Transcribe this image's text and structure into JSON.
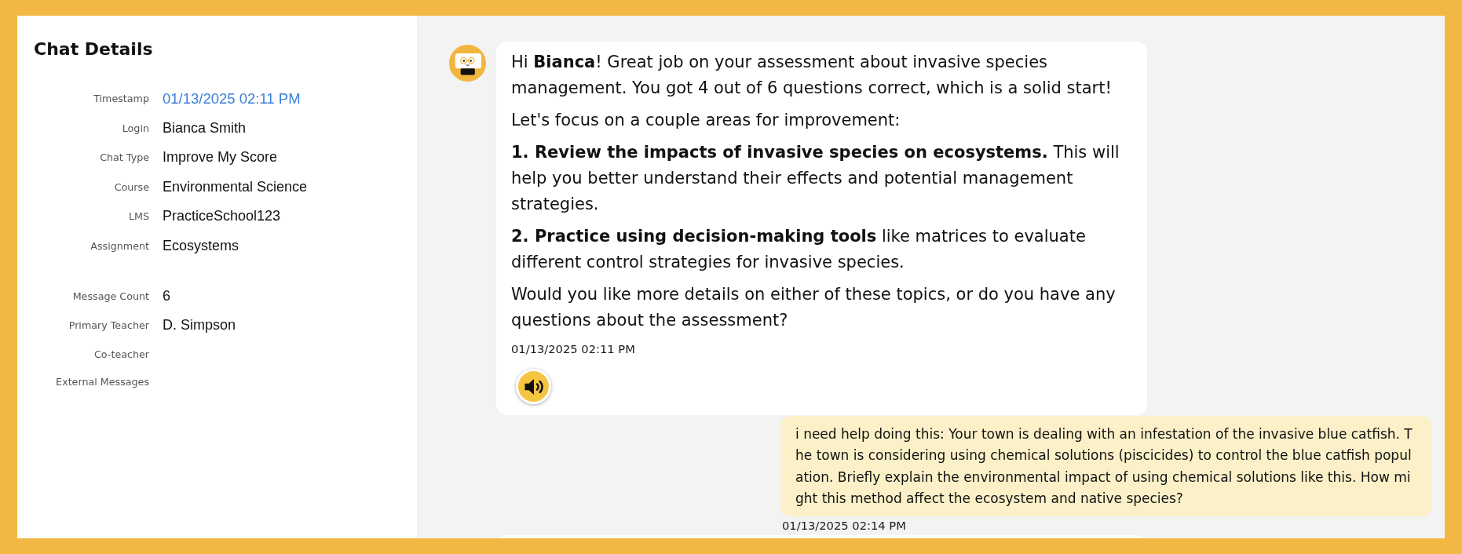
{
  "chat_details": {
    "title": "Chat Details",
    "groups": [
      [
        {
          "label": "Timestamp",
          "value": "01/13/2025 02:11 PM",
          "kind": "link"
        },
        {
          "label": "Login",
          "value": "Bianca Smith",
          "kind": "text"
        },
        {
          "label": "Chat Type",
          "value": "Improve My Score",
          "kind": "text"
        },
        {
          "label": "Course",
          "value": "Environmental Science",
          "kind": "text"
        },
        {
          "label": "LMS",
          "value": "PracticeSchool123",
          "kind": "text"
        },
        {
          "label": "Assignment",
          "value": "Ecosystems",
          "kind": "text"
        }
      ],
      [
        {
          "label": "Message Count",
          "value": "6",
          "kind": "text"
        },
        {
          "label": "Primary Teacher",
          "value": "D. Simpson",
          "kind": "text"
        },
        {
          "label": "Co-teacher"
        },
        {
          "label": "External Messages"
        }
      ]
    ]
  },
  "messages": [
    {
      "kind": "bot",
      "paragraphs": [
        "Hi **Bianca**! Great job on your assessment about invasive species management. You got 4 out of 6 questions correct, which is a solid start!",
        "Let's focus on a couple areas for improvement:",
        "**1. Review the impacts of invasive species on ecosystems.** This will help you better understand their effects and potential management strategies.",
        "**2. Practice using decision-making tools** like matrices to evaluate different control strategies for invasive species.",
        "Would you like more details on either of these topics, or do you have any questions about the assessment?"
      ],
      "time": "01/13/2025 02:11 PM"
    },
    {
      "kind": "user",
      "text": "i need help doing this: Your town is dealing with an infestation of the invasive blue catfish. The town is considering using chemical solutions (piscicides) to control the blue catfish population. Briefly explain the environmental impact of using chemical solutions like this. How might this method affect the ecosystem and native species?",
      "time": "01/13/2025 02:14 PM"
    },
    {
      "kind": "bot"
    }
  ]
}
